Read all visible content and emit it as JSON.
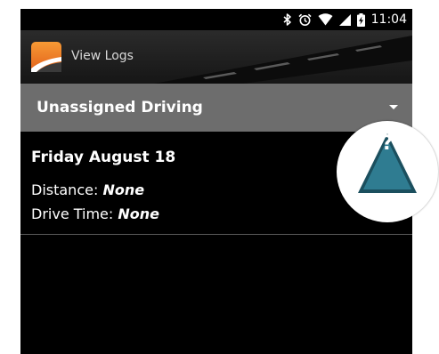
{
  "status_bar": {
    "time": "11:04",
    "icons": [
      "bluetooth-icon",
      "alarm-icon",
      "wifi-icon",
      "signal-icon",
      "battery-charging-icon"
    ]
  },
  "app_bar": {
    "title": "View Logs",
    "logo_icon": "road-logo-icon"
  },
  "dropdown": {
    "selected": "Unassigned Driving"
  },
  "log_entry": {
    "date": "Friday August 18",
    "distance_label": "Distance:",
    "distance_value": "None",
    "drive_time_label": "Drive Time:",
    "drive_time_value": "None"
  },
  "help": {
    "mark": "?",
    "icon": "help-triangle-icon"
  },
  "colors": {
    "background": "#000000",
    "dropdown": "#6d6d6d",
    "help_triangle": "#2f7c91",
    "logo_orange": "#f07a1e"
  }
}
